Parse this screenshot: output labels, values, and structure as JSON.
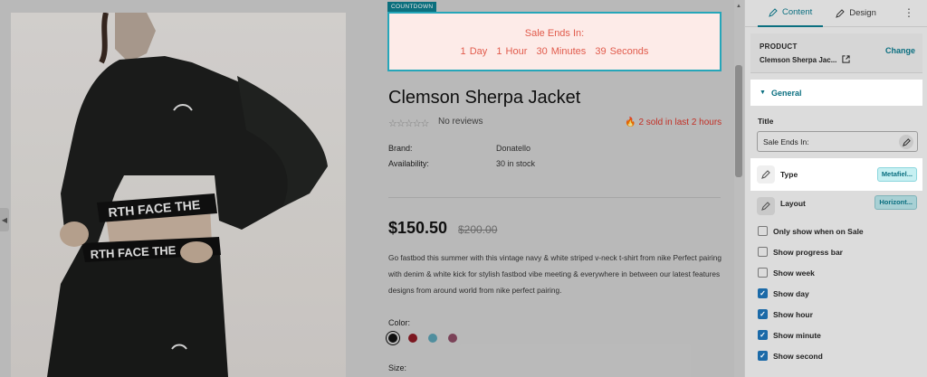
{
  "countdown": {
    "tag": "COUNTDOWN",
    "title": "Sale Ends In:",
    "days": "1 Day",
    "hours": "1 Hour",
    "minutes": "30 Minutes",
    "seconds": "39 Seconds"
  },
  "product": {
    "title": "Clemson Sherpa Jacket",
    "reviews": "No reviews",
    "sold_text": "2 sold in last 2 hours",
    "brand_label": "Brand:",
    "brand_value": "Donatello",
    "availability_label": "Availability:",
    "availability_value": "30 in stock",
    "price": "$150.50",
    "compare_price": "$200.00",
    "description": "Go fastbod this summer with this vintage navy & white striped v-neck t-shirt from nike Perfect pairing with denim & white kick for stylish fastbod vibe meeting & everywhere in between our latest features designs from around world from nike perfect pairing.",
    "color_label": "Color:",
    "size_label": "Size:",
    "swatch_colors": [
      "#111111",
      "#8b1a24",
      "#5a9fb0",
      "#8a4a62"
    ]
  },
  "panel": {
    "tab_content": "Content",
    "tab_design": "Design",
    "product_label": "PRODUCT",
    "product_name": "Clemson Sherpa Jac...",
    "change_label": "Change",
    "general_label": "General",
    "title_label": "Title",
    "title_value": "Sale Ends In:",
    "type_label": "Type",
    "type_value": "Metafiel...",
    "layout_label": "Layout",
    "layout_value": "Horizont...",
    "options": [
      {
        "label": "Only show when on Sale",
        "checked": false
      },
      {
        "label": "Show progress bar",
        "checked": false
      },
      {
        "label": "Show week",
        "checked": false
      },
      {
        "label": "Show day",
        "checked": true
      },
      {
        "label": "Show hour",
        "checked": true
      },
      {
        "label": "Show minute",
        "checked": true
      },
      {
        "label": "Show second",
        "checked": true
      }
    ]
  },
  "colors": {
    "accent": "#0b6f80",
    "countdown_text": "#e15b4c",
    "countdown_bg": "#fdebe8",
    "highlight_border": "#26a6b9",
    "sold": "#d8352a",
    "checkbox": "#1b6aa8"
  }
}
